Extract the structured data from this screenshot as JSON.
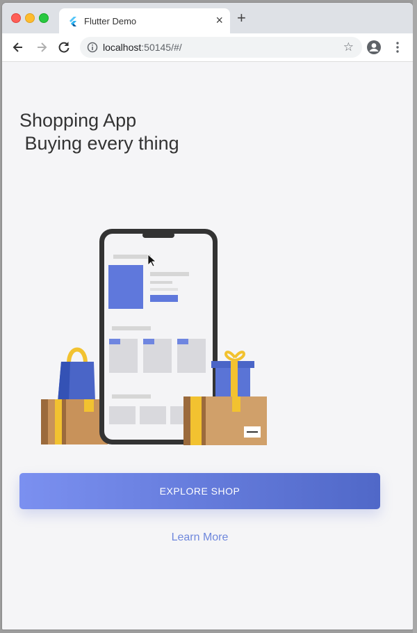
{
  "browser": {
    "tab_title": "Flutter Demo",
    "close_glyph": "×",
    "newtab_glyph": "+",
    "url_host": "localhost",
    "url_rest": ":50145/#/",
    "star_glyph": "☆",
    "icons": [
      "back-icon",
      "forward-icon",
      "reload-icon",
      "info-icon",
      "star-icon",
      "account-icon",
      "menu-icon",
      "flutter-icon"
    ]
  },
  "app": {
    "headline": "Shopping App\n Buying every thing",
    "explore_label": "EXPLORE SHOP",
    "learn_more": "Learn More",
    "accent": "#5f78dc"
  }
}
